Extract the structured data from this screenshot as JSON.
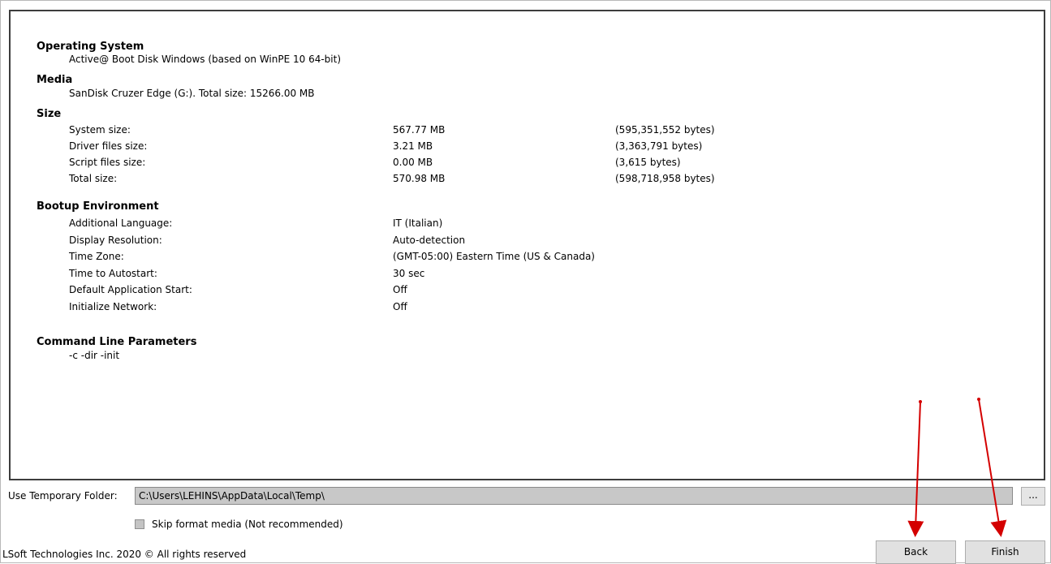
{
  "os": {
    "title": "Operating System",
    "value": "Active@ Boot Disk Windows (based on WinPE 10 64-bit)"
  },
  "media": {
    "title": "Media",
    "value": "SanDisk Cruzer Edge (G:). Total size: 15266.00 MB"
  },
  "size": {
    "title": "Size",
    "rows": [
      {
        "label": "System size:",
        "value": "567.77 MB",
        "bytes": "(595,351,552 bytes)"
      },
      {
        "label": "Driver files size:",
        "value": "3.21 MB",
        "bytes": "(3,363,791 bytes)"
      },
      {
        "label": "Script files size:",
        "value": "0.00 MB",
        "bytes": "(3,615 bytes)"
      },
      {
        "label": "Total size:",
        "value": "570.98 MB",
        "bytes": "(598,718,958 bytes)"
      }
    ]
  },
  "bootup": {
    "title": "Bootup Environment",
    "rows": [
      {
        "label": "Additional Language:",
        "value": "IT (Italian)"
      },
      {
        "label": "Display Resolution:",
        "value": "Auto-detection"
      },
      {
        "label": "Time Zone:",
        "value": "(GMT-05:00) Eastern Time (US & Canada)"
      },
      {
        "label": "Time to Autostart:",
        "value": "30 sec"
      },
      {
        "label": "Default Application Start:",
        "value": "Off"
      },
      {
        "label": "Initialize Network:",
        "value": "Off"
      }
    ]
  },
  "cmd": {
    "title": "Command Line Parameters",
    "value": "-c -dir -init"
  },
  "temp_folder": {
    "label": "Use Temporary Folder:",
    "value": "C:\\Users\\LEHINS\\AppData\\Local\\Temp\\",
    "browse_label": "..."
  },
  "skip_format": {
    "label": "Skip format media (Not recommended)",
    "checked": false
  },
  "footer": {
    "copyright": "LSoft Technologies Inc. 2020 © All rights reserved"
  },
  "buttons": {
    "back": "Back",
    "finish": "Finish"
  },
  "colors": {
    "annotation_arrow": "#d40000"
  }
}
